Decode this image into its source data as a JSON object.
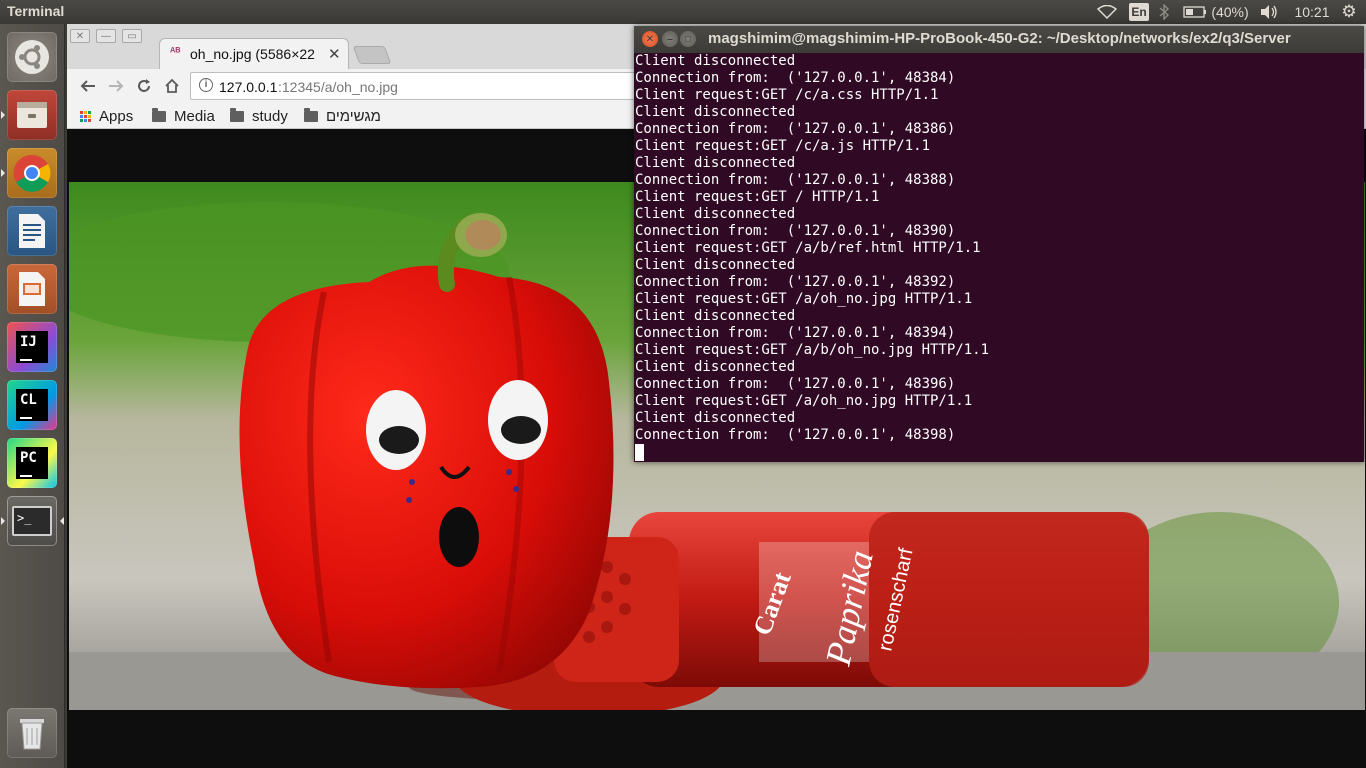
{
  "top_panel": {
    "app_title": "Terminal",
    "lang": "En",
    "battery": "(40%)",
    "clock": "10:21"
  },
  "launcher": {
    "items": [
      "ubuntu-dash",
      "files",
      "chromium",
      "writer",
      "impress",
      "intellij",
      "clion",
      "pycharm",
      "terminal",
      "trash"
    ]
  },
  "browser": {
    "tab_title": "oh_no.jpg (5586×22",
    "url_host": "127.0.0.1",
    "url_path": ":12345/a/oh_no.jpg",
    "bookmarks": [
      "Apps",
      "Media",
      "study",
      "מגשימים"
    ]
  },
  "image": {
    "jar_brand": "Carat",
    "jar_text_1": "Paprika",
    "jar_text_2": "rosenscharf"
  },
  "terminal": {
    "title": "magshimim@magshimim-HP-ProBook-450-G2: ~/Desktop/networks/ex2/q3/Server",
    "lines": [
      "Client disconnected",
      "Connection from:  ('127.0.0.1', 48384)",
      "Client request:GET /c/a.css HTTP/1.1",
      "Client disconnected",
      "Connection from:  ('127.0.0.1', 48386)",
      "Client request:GET /c/a.js HTTP/1.1",
      "Client disconnected",
      "Connection from:  ('127.0.0.1', 48388)",
      "Client request:GET / HTTP/1.1",
      "Client disconnected",
      "Connection from:  ('127.0.0.1', 48390)",
      "Client request:GET /a/b/ref.html HTTP/1.1",
      "Client disconnected",
      "Connection from:  ('127.0.0.1', 48392)",
      "Client request:GET /a/oh_no.jpg HTTP/1.1",
      "Client disconnected",
      "Connection from:  ('127.0.0.1', 48394)",
      "Client request:GET /a/b/oh_no.jpg HTTP/1.1",
      "Client disconnected",
      "Connection from:  ('127.0.0.1', 48396)",
      "Client request:GET /a/oh_no.jpg HTTP/1.1",
      "Client disconnected",
      "Connection from:  ('127.0.0.1', 48398)"
    ]
  }
}
